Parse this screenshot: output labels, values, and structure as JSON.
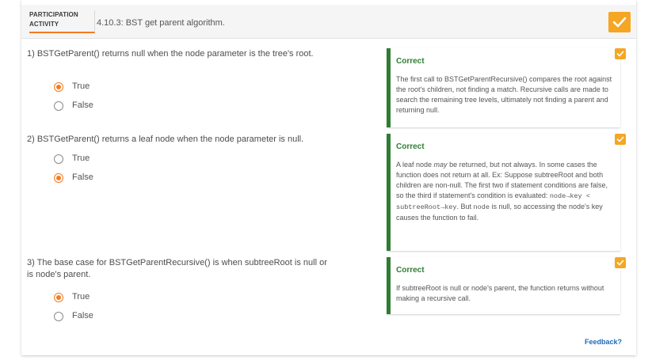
{
  "activity": {
    "label_line1": "PARTICIPATION",
    "label_line2": "ACTIVITY",
    "title": "4.10.3: BST get parent algorithm.",
    "accent_color": "#f47b20",
    "check_color": "#f5a623",
    "correct_color": "#2e7d32"
  },
  "questions": [
    {
      "number": "1)",
      "text": "BSTGetParent() returns null when the node parameter is the tree's root.",
      "choices": [
        {
          "label": "True",
          "selected": true
        },
        {
          "label": "False",
          "selected": false
        }
      ],
      "explanation_heading": "Correct",
      "explanation": "The first call to BSTGetParentRecursive() compares the root against the root's children, not finding a match. Recursive calls are made to search the remaining tree levels, ultimately not finding a parent and returning null."
    },
    {
      "number": "2)",
      "text": "BSTGetParent() returns a leaf node when the node parameter is null.",
      "choices": [
        {
          "label": "True",
          "selected": false
        },
        {
          "label": "False",
          "selected": true
        }
      ],
      "explanation_heading": "Correct",
      "explanation_parts": {
        "p1": "A leaf node ",
        "p1_em": "may",
        "p2": " be returned, but not always. In some cases the function does not return at all. Ex: Suppose subtreeRoot and both children are non-null. The first two if statement conditions are false, so the third if statement's condition is evaluated: ",
        "code1": "node→key <",
        "code2": "subtreeRoot→key",
        "p3": ". But ",
        "code3": "node",
        "p4": " is null, so accessing the node's key causes the function to fail."
      }
    },
    {
      "number": "3)",
      "text": "The base case for BSTGetParentRecursive() is when subtreeRoot is null or is node's parent.",
      "choices": [
        {
          "label": "True",
          "selected": true
        },
        {
          "label": "False",
          "selected": false
        }
      ],
      "explanation_heading": "Correct",
      "explanation": "If subtreeRoot is null or node's parent, the function returns without making a recursive call."
    }
  ],
  "feedback_link": "Feedback?"
}
